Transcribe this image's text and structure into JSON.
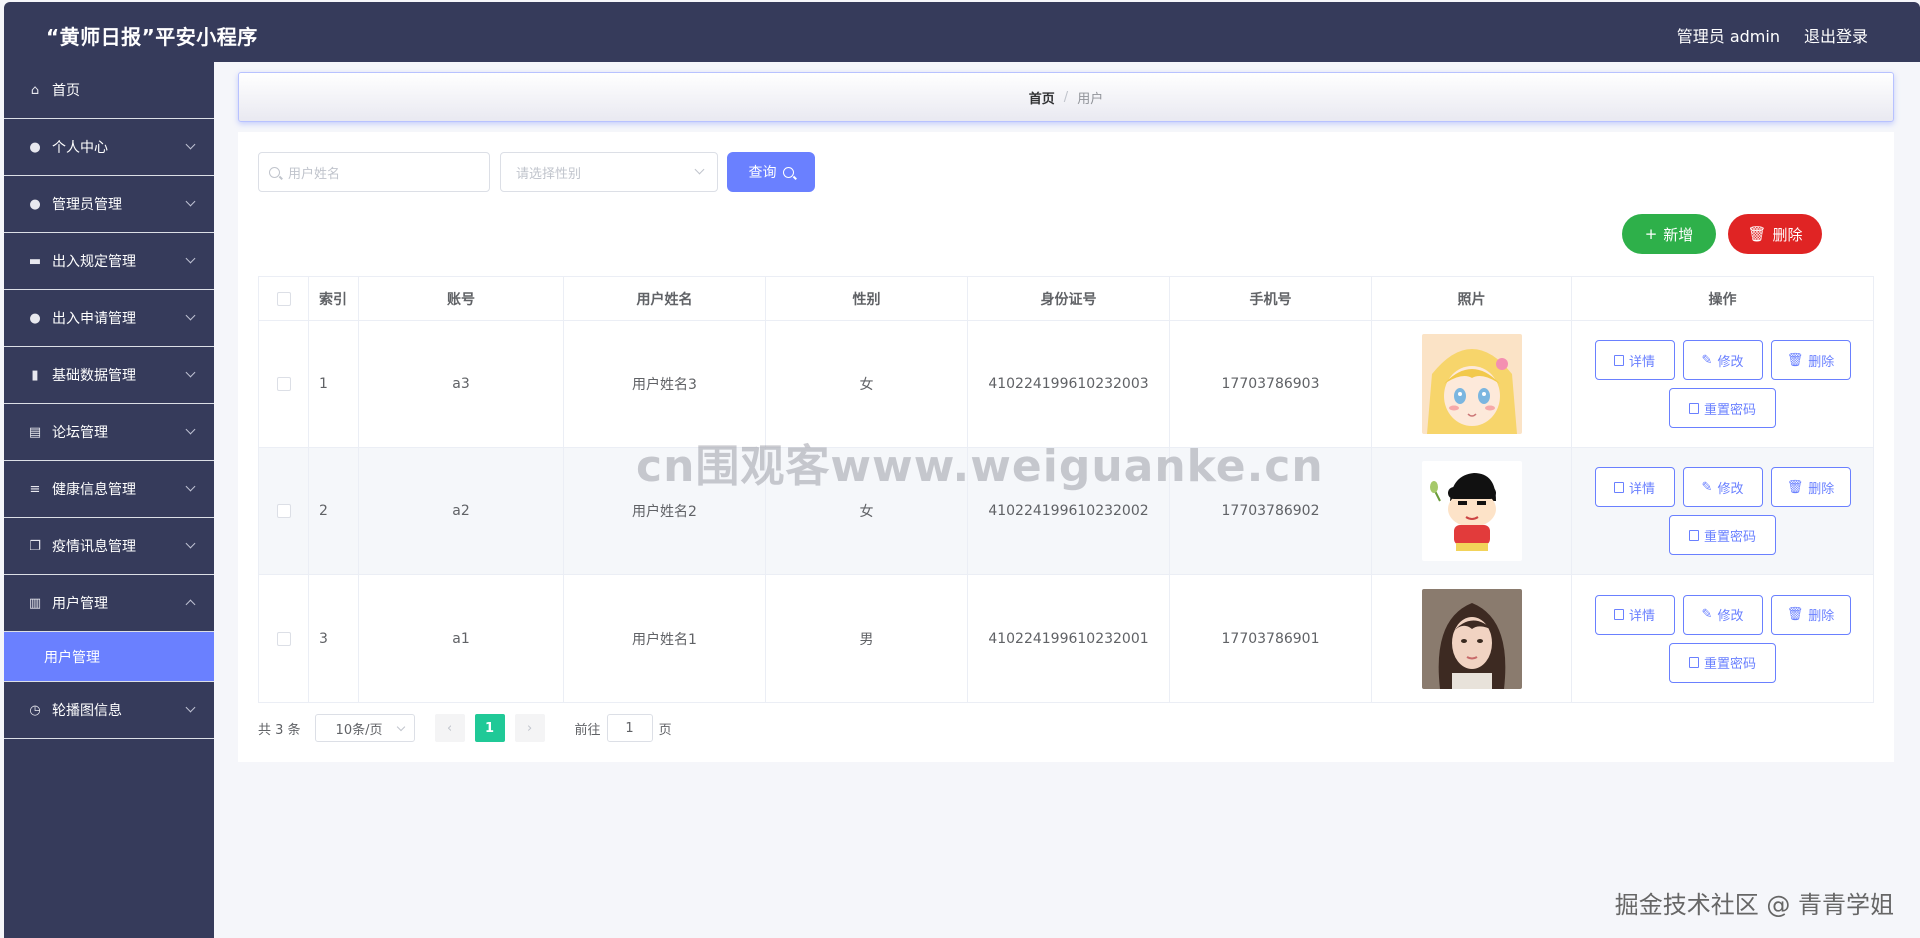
{
  "app": {
    "title": "“黄师日报”平安小程序"
  },
  "header": {
    "user_label": "管理员 admin",
    "logout_label": "退出登录"
  },
  "sidebar": {
    "items": [
      {
        "label": "首页",
        "icon": "home-icon",
        "chevron": ""
      },
      {
        "label": "个人中心",
        "icon": "user-icon",
        "chevron": "down"
      },
      {
        "label": "管理员管理",
        "icon": "admin-icon",
        "chevron": "down"
      },
      {
        "label": "出入规定管理",
        "icon": "briefcase-icon",
        "chevron": "down"
      },
      {
        "label": "出入申请管理",
        "icon": "user-icon",
        "chevron": "down"
      },
      {
        "label": "基础数据管理",
        "icon": "bar-chart-icon",
        "chevron": "down"
      },
      {
        "label": "论坛管理",
        "icon": "clipboard-icon",
        "chevron": "down"
      },
      {
        "label": "健康信息管理",
        "icon": "sliders-icon",
        "chevron": "down"
      },
      {
        "label": "疫情讯息管理",
        "icon": "copy-icon",
        "chevron": "down"
      },
      {
        "label": "用户管理",
        "icon": "library-icon",
        "chevron": "up"
      }
    ],
    "sub_item": "用户管理",
    "last_item": {
      "label": "轮播图信息",
      "icon": "clock-icon",
      "chevron": "down"
    }
  },
  "breadcrumb": {
    "home": "首页",
    "separator": "/",
    "current": "用户"
  },
  "search": {
    "name_placeholder": "用户姓名",
    "gender_placeholder": "请选择性别",
    "query_label": "查询"
  },
  "actions": {
    "add_label": "新增",
    "delete_label": "删除"
  },
  "table": {
    "headers": [
      "索引",
      "账号",
      "用户姓名",
      "性别",
      "身份证号",
      "手机号",
      "照片",
      "操作"
    ],
    "rows": [
      {
        "index": "1",
        "account": "a3",
        "name": "用户姓名3",
        "gender": "女",
        "id_number": "410224199610232003",
        "phone": "17703786903",
        "photo": "anime-girl"
      },
      {
        "index": "2",
        "account": "a2",
        "name": "用户姓名2",
        "gender": "女",
        "id_number": "410224199610232002",
        "phone": "17703786902",
        "photo": "cartoon-boy"
      },
      {
        "index": "3",
        "account": "a1",
        "name": "用户姓名1",
        "gender": "男",
        "id_number": "410224199610232001",
        "phone": "17703786901",
        "photo": "portrait"
      }
    ],
    "row_actions": {
      "detail": "详情",
      "edit": "修改",
      "delete": "删除",
      "reset": "重置密码"
    }
  },
  "pagination": {
    "total": "共 3 条",
    "page_size": "10条/页",
    "current_page": "1",
    "goto_prefix": "前往",
    "goto_value": "1",
    "goto_suffix": "页"
  },
  "watermark": "cn围观客www.weiguanke.cn",
  "corner_watermark": "掘金技术社区 @ 青青学姐",
  "colors": {
    "topbar": "#363b5b",
    "accent": "#6a80ff",
    "success": "#2eb04a",
    "danger": "#e02424",
    "page_active": "#20c997"
  }
}
